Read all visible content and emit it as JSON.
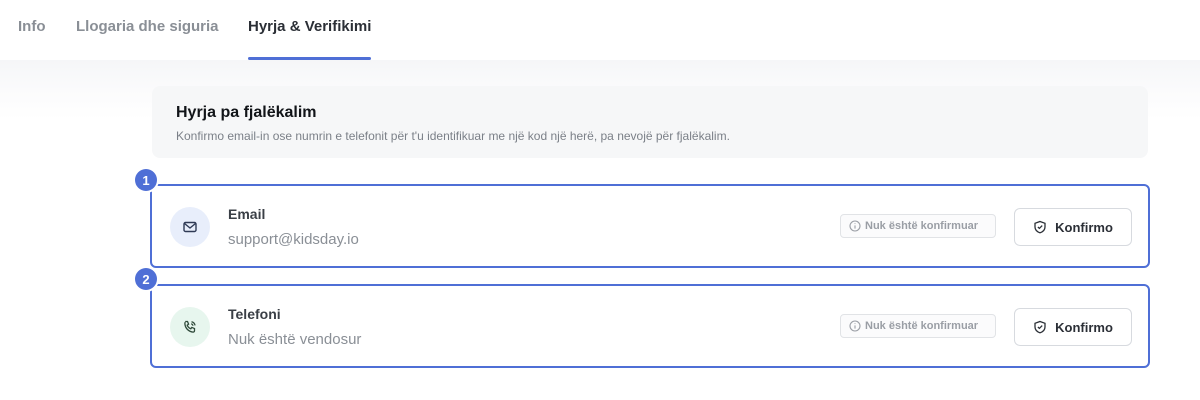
{
  "tabs": [
    {
      "label": "Info"
    },
    {
      "label": "Llogaria dhe siguria"
    },
    {
      "label": "Hyrja & Verifikimi"
    }
  ],
  "section": {
    "title": "Hyrja pa fjalëkalim",
    "description": "Konfirmo email-in ose numrin e telefonit për t'u identifikuar me një kod një herë, pa nevojë për fjalëkalim."
  },
  "cards": [
    {
      "number": "1",
      "title": "Email",
      "value": "support@kidsday.io",
      "status": "Nuk është konfirmuar",
      "button": "Konfirmo",
      "icon": "mail-icon"
    },
    {
      "number": "2",
      "title": "Telefoni",
      "value": "Nuk është vendosur",
      "status": "Nuk është konfirmuar",
      "button": "Konfirmo",
      "icon": "phone-icon"
    }
  ],
  "colors": {
    "accent": "#4f6fd6",
    "email_icon_bg": "#e8eefb",
    "phone_icon_bg": "#e7f6ee"
  }
}
